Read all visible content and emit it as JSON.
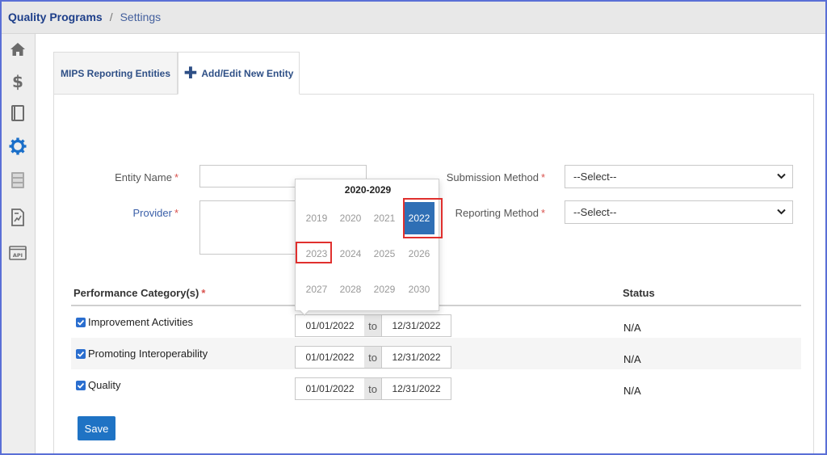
{
  "breadcrumb": {
    "root": "Quality Programs",
    "separator": "/",
    "current": "Settings"
  },
  "sidebar": {
    "icons": [
      "home-icon",
      "dollar-icon",
      "book-icon",
      "gear-icon",
      "server-icon",
      "report-icon",
      "api-icon"
    ],
    "active": "gear-icon",
    "api_label": "API"
  },
  "tabs": {
    "mips": "MIPS Reporting Entities",
    "add_edit": "Add/Edit New Entity"
  },
  "form": {
    "entity_name_label": "Entity Name",
    "provider_label": "Provider",
    "submission_method_label": "Submission Method",
    "reporting_method_label": "Reporting Method",
    "required_mark": "*",
    "submission_method_value": "--Select--",
    "reporting_method_value": "--Select--"
  },
  "table": {
    "header_category": "Performance Category(s)",
    "header_status": "Status",
    "to_label": "to",
    "rows": [
      {
        "category": "Improvement Activities",
        "checked": true,
        "start": "01/01/2022",
        "end": "12/31/2022",
        "status": "N/A"
      },
      {
        "category": "Promoting Interoperability",
        "checked": true,
        "start": "01/01/2022",
        "end": "12/31/2022",
        "status": "N/A"
      },
      {
        "category": "Quality",
        "checked": true,
        "start": "01/01/2022",
        "end": "12/31/2022",
        "status": "N/A"
      }
    ]
  },
  "year_picker": {
    "title": "2020-2029",
    "years": [
      "2019",
      "2020",
      "2021",
      "2022",
      "2023",
      "2024",
      "2025",
      "2026",
      "2027",
      "2028",
      "2029",
      "2030"
    ],
    "selected": "2022",
    "highlighted": [
      "2022",
      "2023"
    ]
  },
  "save_label": "Save",
  "colors": {
    "accent": "#1f73c4",
    "selected_year": "#2f6fb5",
    "required": "#d9534f",
    "highlight": "#e0302e",
    "breadcrumb": "#1e3f8a"
  }
}
